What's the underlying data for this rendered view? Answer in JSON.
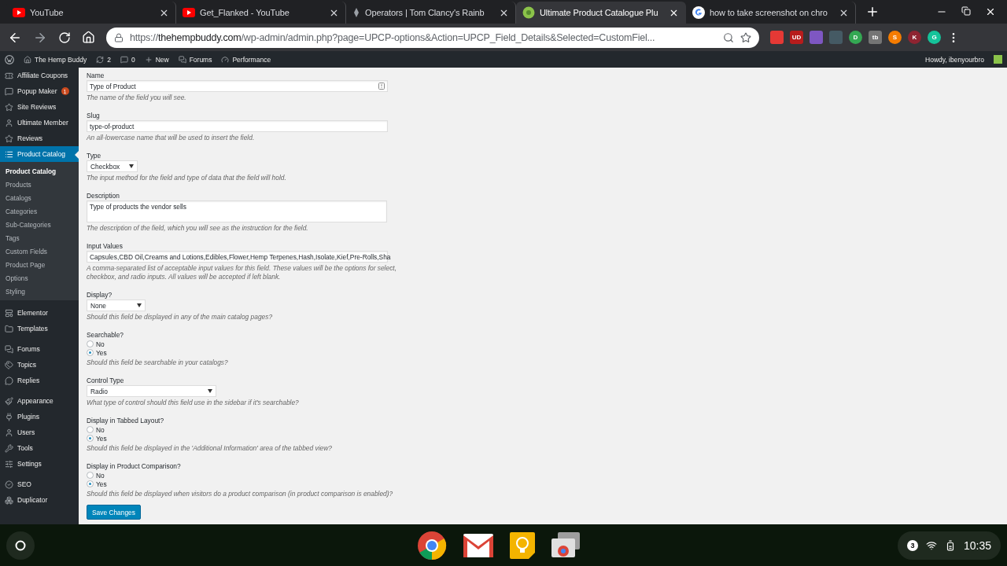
{
  "browser": {
    "tabs": [
      {
        "title": "YouTube",
        "kind": "youtube",
        "selected": false
      },
      {
        "title": "Get_Flanked - YouTube",
        "kind": "youtube",
        "selected": false
      },
      {
        "title": "Operators | Tom Clancy's Rainb",
        "kind": "game",
        "selected": false
      },
      {
        "title": "Ultimate Product Catalogue Plu",
        "kind": "catalogue",
        "selected": true
      },
      {
        "title": "how to take screenshot on chro",
        "kind": "google",
        "selected": false
      }
    ],
    "url": {
      "scheme": "https://",
      "host": "thehempbuddy.com",
      "path": "/wp-admin/admin.php?page=UPCP-options&Action=UPCP_Field_Details&Selected=CustomFiel..."
    },
    "extensions": [
      {
        "color": "#e53935"
      },
      {
        "label": "UD",
        "color": "#b71c1c"
      },
      {
        "color": "#7e57c2"
      },
      {
        "color": "#455a64"
      },
      {
        "label": "D",
        "color": "#34a853"
      },
      {
        "label": "tb",
        "color": "#757575"
      },
      {
        "label": "S",
        "color": "#f57c00"
      },
      {
        "label": "K",
        "color": "#8e2431"
      },
      {
        "label": "G",
        "color": "#15c39a"
      }
    ]
  },
  "admin_bar": {
    "items": [
      {
        "label": "The Hemp Buddy"
      },
      {
        "label": "2"
      },
      {
        "label": "0"
      },
      {
        "label": "New"
      },
      {
        "label": "Forums"
      },
      {
        "label": "Performance"
      }
    ],
    "greeting": "Howdy, ibenyourbro"
  },
  "sidebar": {
    "groups": [
      [
        {
          "label": "Affiliate Coupons",
          "selected": false
        },
        {
          "label": "Popup Maker",
          "badge": "1",
          "selected": false
        },
        {
          "label": "Site Reviews",
          "selected": false
        },
        {
          "label": "Ultimate Member",
          "selected": false
        },
        {
          "label": "Reviews",
          "selected": false
        },
        {
          "label": "Product Catalog",
          "selected": true,
          "children": [
            {
              "label": "Product Catalog",
              "selected": true
            },
            {
              "label": "Products",
              "selected": false
            },
            {
              "label": "Catalogs",
              "selected": false
            },
            {
              "label": "Categories",
              "selected": false
            },
            {
              "label": "Sub-Categories",
              "selected": false
            },
            {
              "label": "Tags",
              "selected": false
            },
            {
              "label": "Custom Fields",
              "selected": false
            },
            {
              "label": "Product Page",
              "selected": false
            },
            {
              "label": "Options",
              "selected": false
            },
            {
              "label": "Styling",
              "selected": false
            }
          ]
        }
      ],
      [
        {
          "label": "Elementor",
          "selected": false
        },
        {
          "label": "Templates",
          "selected": false
        }
      ],
      [
        {
          "label": "Forums",
          "selected": false
        },
        {
          "label": "Topics",
          "selected": false
        },
        {
          "label": "Replies",
          "selected": false
        }
      ],
      [
        {
          "label": "Appearance",
          "selected": false
        },
        {
          "label": "Plugins",
          "selected": false
        },
        {
          "label": "Users",
          "selected": false
        },
        {
          "label": "Tools",
          "selected": false
        },
        {
          "label": "Settings",
          "selected": false
        }
      ],
      [
        {
          "label": "SEO",
          "selected": false
        },
        {
          "label": "Duplicator",
          "selected": false
        }
      ]
    ]
  },
  "form": {
    "fields": [
      {
        "kind": "text",
        "label": "Name",
        "value": "Type of Product",
        "hint": "The name of the field you will see."
      },
      {
        "kind": "text",
        "label": "Slug",
        "value": "type-of-product",
        "hint": "An all-lowercase name that will be used to insert the field."
      },
      {
        "kind": "select",
        "label": "Type",
        "value": "Checkbox",
        "hint": "The input method for the field and type of data that the field will hold."
      },
      {
        "kind": "textarea",
        "label": "Description",
        "value": "Type of products the vendor sells",
        "hint": "The description of the field, which you will see as the instruction for the field."
      },
      {
        "kind": "text",
        "label": "Input Values",
        "value": "Capsules,CBD Oil,Creams and Lotions,Edibles,Flower,Hemp Terpenes,Hash,Isolate,Kief,Pre-Rolls,Sha",
        "hint": "A comma-separated list of acceptable input values for this field. These values will be the options for select, checkbox, and radio inputs. All values will be accepted if left blank."
      },
      {
        "kind": "select",
        "label": "Display?",
        "value": "None",
        "hint": "Should this field be displayed in any of the main catalog pages?"
      },
      {
        "kind": "radio",
        "label": "Searchable?",
        "options": [
          {
            "label": "No",
            "selected": false
          },
          {
            "label": "Yes",
            "selected": true
          }
        ],
        "hint": "Should this field be searchable in your catalogs?"
      },
      {
        "kind": "select",
        "label": "Control Type",
        "value": "Radio",
        "hint": "What type of control should this field use in the sidebar if it's searchable?"
      },
      {
        "kind": "radio",
        "label": "Display in Tabbed Layout?",
        "options": [
          {
            "label": "No",
            "selected": false
          },
          {
            "label": "Yes",
            "selected": true
          }
        ],
        "hint": "Should this field be displayed in the 'Additional Information' area of the tabbed view?"
      },
      {
        "kind": "radio",
        "label": "Display in Product Comparison?",
        "options": [
          {
            "label": "No",
            "selected": false
          },
          {
            "label": "Yes",
            "selected": true
          }
        ],
        "hint": "Should this field be displayed when visitors do a product comparison (in product comparison is enabled)?"
      }
    ],
    "submit": "Save Changes"
  },
  "shelf": {
    "notifications": "3",
    "time": "10:35"
  }
}
